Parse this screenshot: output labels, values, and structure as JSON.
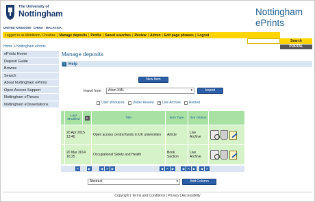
{
  "header": {
    "univ_small": "The University of",
    "univ_big": "Nottingham",
    "countries": "UNITED KINGDOM · CHINA · MALAYSIA",
    "site_title_line1": "Nottingham",
    "site_title_line2": "ePrints"
  },
  "navbar": {
    "logged_in": "Logged in as Middleton, Christine",
    "links": [
      "Manage deposits",
      "Profile",
      "Saved searches",
      "Review",
      "Admin",
      "Edit page phrases",
      "Logout"
    ]
  },
  "search": {
    "input_value": "",
    "button_label": "Search",
    "portal_label": "PORTAL"
  },
  "breadcrumb": {
    "home": "Home",
    "separator": ">",
    "current": "Nottingham ePrints"
  },
  "sidebar": {
    "items": [
      {
        "label": "ePrints Home"
      },
      {
        "label": "Deposit Guide"
      },
      {
        "label": "Browse"
      },
      {
        "label": "Search"
      },
      {
        "label": "About Nottingham ePrints"
      },
      {
        "label": "Open Access Support"
      },
      {
        "label": "Nottingham eTheses"
      },
      {
        "label": "Nottingham eDissertations"
      }
    ]
  },
  "main": {
    "title": "Manage deposits",
    "help_label": "Help",
    "new_item_label": "New Item",
    "import_label": "Import from",
    "import_selected": "Atom XML",
    "import_button": "Import",
    "filters": [
      {
        "label": "User Workarea",
        "checked": false
      },
      {
        "label": "Under Review",
        "checked": false
      },
      {
        "label": "Live Archive",
        "checked": true
      },
      {
        "label": "Retired",
        "checked": false
      }
    ]
  },
  "table": {
    "headers": {
      "last_modified": "Last Modified",
      "title": "Title",
      "item_type": "Item Type",
      "item_status": "Item Status"
    },
    "rows": [
      {
        "date": "20 Apr 2015",
        "time": "13:40",
        "title": "Open access central funds in UK universities",
        "type": "Article",
        "status": "Live Archive"
      },
      {
        "date": "20 Mar 2014",
        "time": "16:25",
        "title": "Occupational Safety and Health",
        "type": "Book Section",
        "status": "Live Archive"
      }
    ]
  },
  "columns": {
    "selected": "Abstract",
    "add_button": "Add Column"
  },
  "footer": {
    "copyright": "Copyright",
    "terms": "Terms and Conditions",
    "privacy": "Privacy",
    "accessibility": "Accessibility"
  },
  "colors": {
    "brand_blue": "#1f5f8f",
    "nav_yellow": "#ffd400",
    "table_green": "#d6f2c9",
    "button_blue": "#2c5fa8"
  }
}
